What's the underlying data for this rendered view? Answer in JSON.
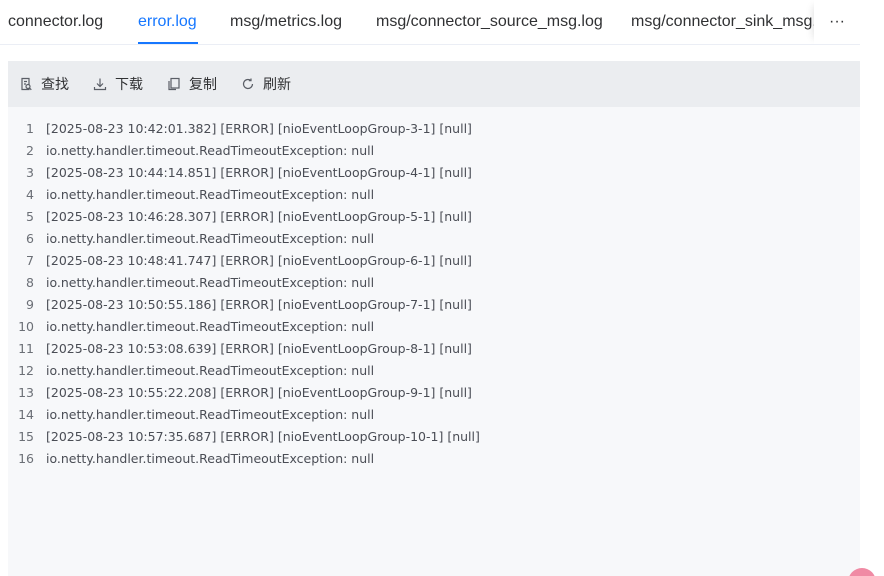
{
  "tabs": [
    {
      "label": "connector.log"
    },
    {
      "label": "error.log",
      "active": true
    },
    {
      "label": "msg/metrics.log"
    },
    {
      "label": "msg/connector_source_msg.log"
    },
    {
      "label": "msg/connector_sink_msg.log"
    }
  ],
  "more_label": "···",
  "toolbar": {
    "search_label": "查找",
    "download_label": "下载",
    "copy_label": "复制",
    "refresh_label": "刷新"
  },
  "log_lines": [
    {
      "n": "1",
      "text": "[2025-08-23 10:42:01.382] [ERROR] [nioEventLoopGroup-3-1] [null]"
    },
    {
      "n": "2",
      "text": "io.netty.handler.timeout.ReadTimeoutException: null"
    },
    {
      "n": "3",
      "text": "[2025-08-23 10:44:14.851] [ERROR] [nioEventLoopGroup-4-1] [null]"
    },
    {
      "n": "4",
      "text": "io.netty.handler.timeout.ReadTimeoutException: null"
    },
    {
      "n": "5",
      "text": "[2025-08-23 10:46:28.307] [ERROR] [nioEventLoopGroup-5-1] [null]"
    },
    {
      "n": "6",
      "text": "io.netty.handler.timeout.ReadTimeoutException: null"
    },
    {
      "n": "7",
      "text": "[2025-08-23 10:48:41.747] [ERROR] [nioEventLoopGroup-6-1] [null]"
    },
    {
      "n": "8",
      "text": "io.netty.handler.timeout.ReadTimeoutException: null"
    },
    {
      "n": "9",
      "text": "[2025-08-23 10:50:55.186] [ERROR] [nioEventLoopGroup-7-1] [null]"
    },
    {
      "n": "10",
      "text": "io.netty.handler.timeout.ReadTimeoutException: null"
    },
    {
      "n": "11",
      "text": "[2025-08-23 10:53:08.639] [ERROR] [nioEventLoopGroup-8-1] [null]"
    },
    {
      "n": "12",
      "text": "io.netty.handler.timeout.ReadTimeoutException: null"
    },
    {
      "n": "13",
      "text": "[2025-08-23 10:55:22.208] [ERROR] [nioEventLoopGroup-9-1] [null]"
    },
    {
      "n": "14",
      "text": "io.netty.handler.timeout.ReadTimeoutException: null"
    },
    {
      "n": "15",
      "text": "[2025-08-23 10:57:35.687] [ERROR] [nioEventLoopGroup-10-1] [null]"
    },
    {
      "n": "16",
      "text": "io.netty.handler.timeout.ReadTimeoutException: null"
    }
  ],
  "colors": {
    "accent": "#1677ff",
    "toolbar_bg": "#ebedf0",
    "panel_bg": "#f7f8fa"
  }
}
